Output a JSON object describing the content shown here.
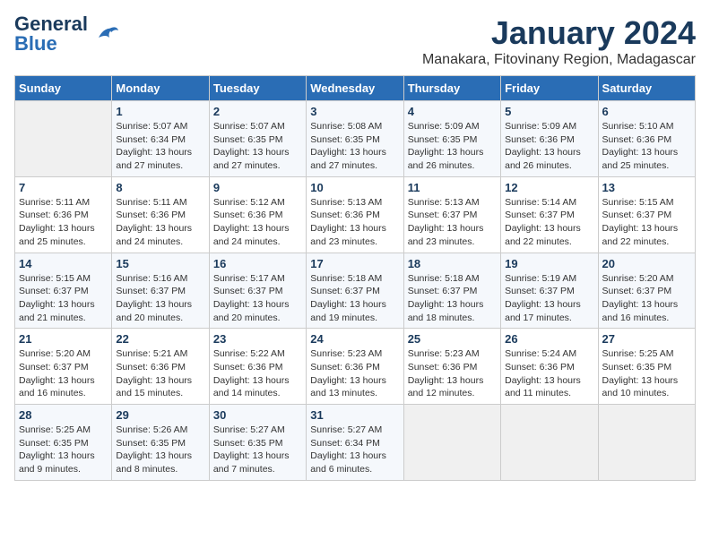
{
  "header": {
    "logo_line1": "General",
    "logo_line2": "Blue",
    "month": "January 2024",
    "location": "Manakara, Fitovinany Region, Madagascar"
  },
  "weekdays": [
    "Sunday",
    "Monday",
    "Tuesday",
    "Wednesday",
    "Thursday",
    "Friday",
    "Saturday"
  ],
  "weeks": [
    [
      {
        "day": "",
        "sunrise": "",
        "sunset": "",
        "daylight": ""
      },
      {
        "day": "1",
        "sunrise": "Sunrise: 5:07 AM",
        "sunset": "Sunset: 6:34 PM",
        "daylight": "Daylight: 13 hours and 27 minutes."
      },
      {
        "day": "2",
        "sunrise": "Sunrise: 5:07 AM",
        "sunset": "Sunset: 6:35 PM",
        "daylight": "Daylight: 13 hours and 27 minutes."
      },
      {
        "day": "3",
        "sunrise": "Sunrise: 5:08 AM",
        "sunset": "Sunset: 6:35 PM",
        "daylight": "Daylight: 13 hours and 27 minutes."
      },
      {
        "day": "4",
        "sunrise": "Sunrise: 5:09 AM",
        "sunset": "Sunset: 6:35 PM",
        "daylight": "Daylight: 13 hours and 26 minutes."
      },
      {
        "day": "5",
        "sunrise": "Sunrise: 5:09 AM",
        "sunset": "Sunset: 6:36 PM",
        "daylight": "Daylight: 13 hours and 26 minutes."
      },
      {
        "day": "6",
        "sunrise": "Sunrise: 5:10 AM",
        "sunset": "Sunset: 6:36 PM",
        "daylight": "Daylight: 13 hours and 25 minutes."
      }
    ],
    [
      {
        "day": "7",
        "sunrise": "Sunrise: 5:11 AM",
        "sunset": "Sunset: 6:36 PM",
        "daylight": "Daylight: 13 hours and 25 minutes."
      },
      {
        "day": "8",
        "sunrise": "Sunrise: 5:11 AM",
        "sunset": "Sunset: 6:36 PM",
        "daylight": "Daylight: 13 hours and 24 minutes."
      },
      {
        "day": "9",
        "sunrise": "Sunrise: 5:12 AM",
        "sunset": "Sunset: 6:36 PM",
        "daylight": "Daylight: 13 hours and 24 minutes."
      },
      {
        "day": "10",
        "sunrise": "Sunrise: 5:13 AM",
        "sunset": "Sunset: 6:36 PM",
        "daylight": "Daylight: 13 hours and 23 minutes."
      },
      {
        "day": "11",
        "sunrise": "Sunrise: 5:13 AM",
        "sunset": "Sunset: 6:37 PM",
        "daylight": "Daylight: 13 hours and 23 minutes."
      },
      {
        "day": "12",
        "sunrise": "Sunrise: 5:14 AM",
        "sunset": "Sunset: 6:37 PM",
        "daylight": "Daylight: 13 hours and 22 minutes."
      },
      {
        "day": "13",
        "sunrise": "Sunrise: 5:15 AM",
        "sunset": "Sunset: 6:37 PM",
        "daylight": "Daylight: 13 hours and 22 minutes."
      }
    ],
    [
      {
        "day": "14",
        "sunrise": "Sunrise: 5:15 AM",
        "sunset": "Sunset: 6:37 PM",
        "daylight": "Daylight: 13 hours and 21 minutes."
      },
      {
        "day": "15",
        "sunrise": "Sunrise: 5:16 AM",
        "sunset": "Sunset: 6:37 PM",
        "daylight": "Daylight: 13 hours and 20 minutes."
      },
      {
        "day": "16",
        "sunrise": "Sunrise: 5:17 AM",
        "sunset": "Sunset: 6:37 PM",
        "daylight": "Daylight: 13 hours and 20 minutes."
      },
      {
        "day": "17",
        "sunrise": "Sunrise: 5:18 AM",
        "sunset": "Sunset: 6:37 PM",
        "daylight": "Daylight: 13 hours and 19 minutes."
      },
      {
        "day": "18",
        "sunrise": "Sunrise: 5:18 AM",
        "sunset": "Sunset: 6:37 PM",
        "daylight": "Daylight: 13 hours and 18 minutes."
      },
      {
        "day": "19",
        "sunrise": "Sunrise: 5:19 AM",
        "sunset": "Sunset: 6:37 PM",
        "daylight": "Daylight: 13 hours and 17 minutes."
      },
      {
        "day": "20",
        "sunrise": "Sunrise: 5:20 AM",
        "sunset": "Sunset: 6:37 PM",
        "daylight": "Daylight: 13 hours and 16 minutes."
      }
    ],
    [
      {
        "day": "21",
        "sunrise": "Sunrise: 5:20 AM",
        "sunset": "Sunset: 6:37 PM",
        "daylight": "Daylight: 13 hours and 16 minutes."
      },
      {
        "day": "22",
        "sunrise": "Sunrise: 5:21 AM",
        "sunset": "Sunset: 6:36 PM",
        "daylight": "Daylight: 13 hours and 15 minutes."
      },
      {
        "day": "23",
        "sunrise": "Sunrise: 5:22 AM",
        "sunset": "Sunset: 6:36 PM",
        "daylight": "Daylight: 13 hours and 14 minutes."
      },
      {
        "day": "24",
        "sunrise": "Sunrise: 5:23 AM",
        "sunset": "Sunset: 6:36 PM",
        "daylight": "Daylight: 13 hours and 13 minutes."
      },
      {
        "day": "25",
        "sunrise": "Sunrise: 5:23 AM",
        "sunset": "Sunset: 6:36 PM",
        "daylight": "Daylight: 13 hours and 12 minutes."
      },
      {
        "day": "26",
        "sunrise": "Sunrise: 5:24 AM",
        "sunset": "Sunset: 6:36 PM",
        "daylight": "Daylight: 13 hours and 11 minutes."
      },
      {
        "day": "27",
        "sunrise": "Sunrise: 5:25 AM",
        "sunset": "Sunset: 6:35 PM",
        "daylight": "Daylight: 13 hours and 10 minutes."
      }
    ],
    [
      {
        "day": "28",
        "sunrise": "Sunrise: 5:25 AM",
        "sunset": "Sunset: 6:35 PM",
        "daylight": "Daylight: 13 hours and 9 minutes."
      },
      {
        "day": "29",
        "sunrise": "Sunrise: 5:26 AM",
        "sunset": "Sunset: 6:35 PM",
        "daylight": "Daylight: 13 hours and 8 minutes."
      },
      {
        "day": "30",
        "sunrise": "Sunrise: 5:27 AM",
        "sunset": "Sunset: 6:35 PM",
        "daylight": "Daylight: 13 hours and 7 minutes."
      },
      {
        "day": "31",
        "sunrise": "Sunrise: 5:27 AM",
        "sunset": "Sunset: 6:34 PM",
        "daylight": "Daylight: 13 hours and 6 minutes."
      },
      {
        "day": "",
        "sunrise": "",
        "sunset": "",
        "daylight": ""
      },
      {
        "day": "",
        "sunrise": "",
        "sunset": "",
        "daylight": ""
      },
      {
        "day": "",
        "sunrise": "",
        "sunset": "",
        "daylight": ""
      }
    ]
  ]
}
